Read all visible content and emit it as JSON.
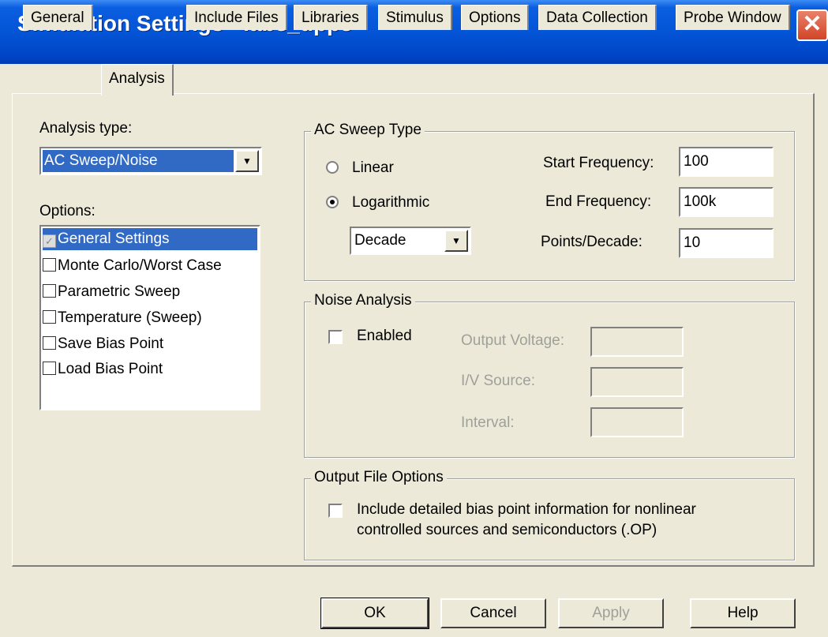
{
  "window": {
    "title": "Simulation Settings - lab3_upp3",
    "close_symbol": "✕"
  },
  "tabs": [
    {
      "label": "General"
    },
    {
      "label": "Analysis"
    },
    {
      "label": "Include Files"
    },
    {
      "label": "Libraries"
    },
    {
      "label": "Stimulus"
    },
    {
      "label": "Options"
    },
    {
      "label": "Data Collection"
    },
    {
      "label": "Probe Window"
    }
  ],
  "analysis": {
    "type_label": "Analysis type:",
    "type_value": "AC Sweep/Noise",
    "options_label": "Options:",
    "options": [
      {
        "label": "General Settings",
        "checked": true,
        "selected": true
      },
      {
        "label": "Monte Carlo/Worst Case",
        "checked": false
      },
      {
        "label": "Parametric Sweep",
        "checked": false
      },
      {
        "label": "Temperature (Sweep)",
        "checked": false
      },
      {
        "label": "Save Bias Point",
        "checked": false
      },
      {
        "label": "Load Bias Point",
        "checked": false
      }
    ]
  },
  "ac_sweep": {
    "legend": "AC Sweep Type",
    "linear_label": "Linear",
    "log_label": "Logarithmic",
    "log_unit": "Decade",
    "start_label": "Start Frequency:",
    "start_value": "100",
    "end_label": "End Frequency:",
    "end_value": "100k",
    "points_label": "Points/Decade:",
    "points_value": "10",
    "selected": "Logarithmic"
  },
  "noise": {
    "legend": "Noise Analysis",
    "enabled_label": "Enabled",
    "output_voltage_label": "Output Voltage:",
    "iv_source_label": "I/V Source:",
    "interval_label": "Interval:"
  },
  "output_file": {
    "legend": "Output File Options",
    "checkbox_line1": "Include detailed bias point information for nonlinear",
    "checkbox_line2": "controlled sources and semiconductors (.OP)"
  },
  "buttons": {
    "ok": "OK",
    "cancel": "Cancel",
    "apply": "Apply",
    "help": "Help"
  },
  "icons": {
    "dropdown_arrow": "▼",
    "check": "✓"
  }
}
